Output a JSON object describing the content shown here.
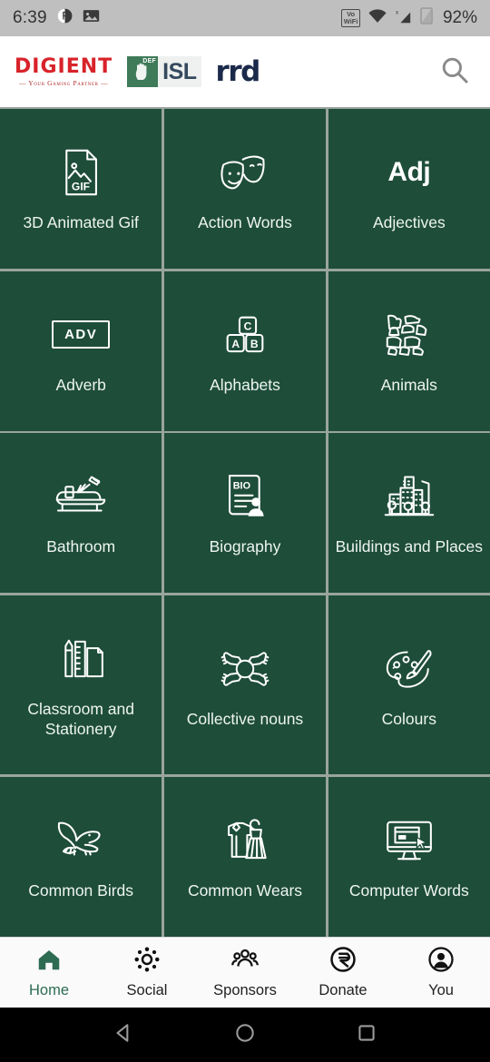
{
  "status_bar": {
    "time": "6:39",
    "battery": "92%",
    "vowifi_line1": "Vo",
    "vowifi_line2": "WiFi",
    "icons": [
      "do-not-disturb-icon",
      "image-icon",
      "vowifi-icon",
      "wifi-icon",
      "signal-no-service-icon",
      "battery-icon"
    ]
  },
  "header": {
    "digient_name": "DIGIENT",
    "digient_tagline": "— Your Gaming Partner —",
    "isl_def": "DEF",
    "isl_text": "ISL",
    "rrd_text": "rrd",
    "search_icon": "search-icon"
  },
  "grid": {
    "tiles": [
      {
        "label": "3D Animated Gif",
        "icon": "gif-file-icon",
        "icon_type": "svg"
      },
      {
        "label": "Action Words",
        "icon": "theater-masks-icon",
        "icon_type": "svg"
      },
      {
        "label": "Adjectives",
        "icon": "adj-text-icon",
        "icon_type": "text",
        "icon_text": "Adj"
      },
      {
        "label": "Adverb",
        "icon": "adv-boxed-text-icon",
        "icon_type": "boxed",
        "icon_text": "ADV"
      },
      {
        "label": "Alphabets",
        "icon": "alphabet-blocks-icon",
        "icon_type": "svg"
      },
      {
        "label": "Animals",
        "icon": "animals-collage-icon",
        "icon_type": "svg"
      },
      {
        "label": "Bathroom",
        "icon": "bathtub-shower-icon",
        "icon_type": "svg"
      },
      {
        "label": "Biography",
        "icon": "biography-document-icon",
        "icon_type": "svg"
      },
      {
        "label": "Buildings and Places",
        "icon": "cityscape-icon",
        "icon_type": "svg"
      },
      {
        "label": "Classroom and Stationery",
        "icon": "pencil-ruler-paper-icon",
        "icon_type": "svg"
      },
      {
        "label": "Collective nouns",
        "icon": "joined-hands-icon",
        "icon_type": "svg"
      },
      {
        "label": "Colours",
        "icon": "paint-palette-icon",
        "icon_type": "svg"
      },
      {
        "label": "Common Birds",
        "icon": "flying-bird-icon",
        "icon_type": "svg"
      },
      {
        "label": "Common Wears",
        "icon": "clothing-icon",
        "icon_type": "svg"
      },
      {
        "label": "Computer Words",
        "icon": "desktop-monitor-icon",
        "icon_type": "svg"
      }
    ]
  },
  "bottom_nav": {
    "active": "Home",
    "items": [
      {
        "label": "Home",
        "icon": "home-icon"
      },
      {
        "label": "Social",
        "icon": "social-network-icon"
      },
      {
        "label": "Sponsors",
        "icon": "people-group-icon"
      },
      {
        "label": "Donate",
        "icon": "rupee-donate-icon"
      },
      {
        "label": "You",
        "icon": "account-avatar-icon"
      }
    ]
  },
  "system_nav": {
    "back": "back-triangle-icon",
    "home": "home-circle-icon",
    "recents": "recents-square-icon"
  },
  "colors": {
    "tile_green": "#1e4d3a",
    "accent_green": "#2d6b52",
    "separator": "#9aa49e",
    "brand_red": "#d8232a",
    "brand_navy": "#1b2a4a",
    "status_bg": "#bfbfbf"
  }
}
